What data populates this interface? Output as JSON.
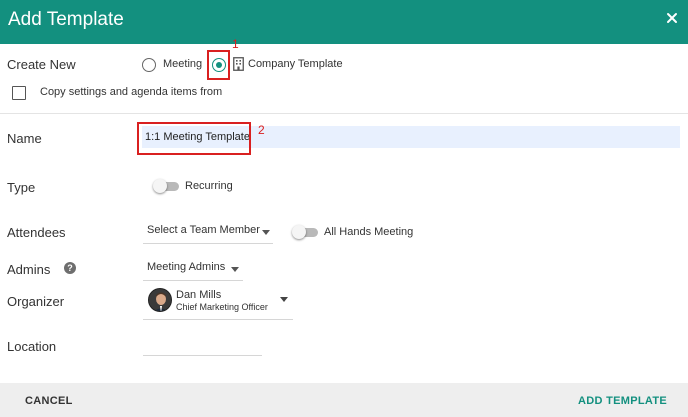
{
  "dialog": {
    "title": "Add Template",
    "close_icon": "close-icon"
  },
  "create_new": {
    "label": "Create New",
    "options": [
      {
        "label": "Meeting",
        "selected": false
      },
      {
        "label": "Company Template",
        "selected": true,
        "icon": "building-icon"
      }
    ],
    "copy_checkbox_label": "Copy settings and agenda items from",
    "copy_checked": false
  },
  "annotations": {
    "marker_1": "1",
    "marker_2": "2",
    "color": "#d92020"
  },
  "name": {
    "label": "Name",
    "value": "1:1 Meeting Template"
  },
  "type": {
    "label": "Type",
    "toggle_label": "Recurring",
    "on": false
  },
  "attendees": {
    "label": "Attendees",
    "select_value": "Select a Team Member",
    "toggle_label": "All Hands Meeting",
    "on": false
  },
  "admins": {
    "label": "Admins",
    "help_icon": "help-icon",
    "select_value": "Meeting Admins"
  },
  "organizer": {
    "label": "Organizer",
    "name": "Dan Mills",
    "role": "Chief Marketing Officer"
  },
  "location": {
    "label": "Location",
    "value": ""
  },
  "footer": {
    "cancel_label": "CANCEL",
    "add_label": "ADD TEMPLATE"
  },
  "colors": {
    "accent": "#13907f",
    "footer_bg": "#eeeeee",
    "field_highlight": "#e8f0fe"
  }
}
